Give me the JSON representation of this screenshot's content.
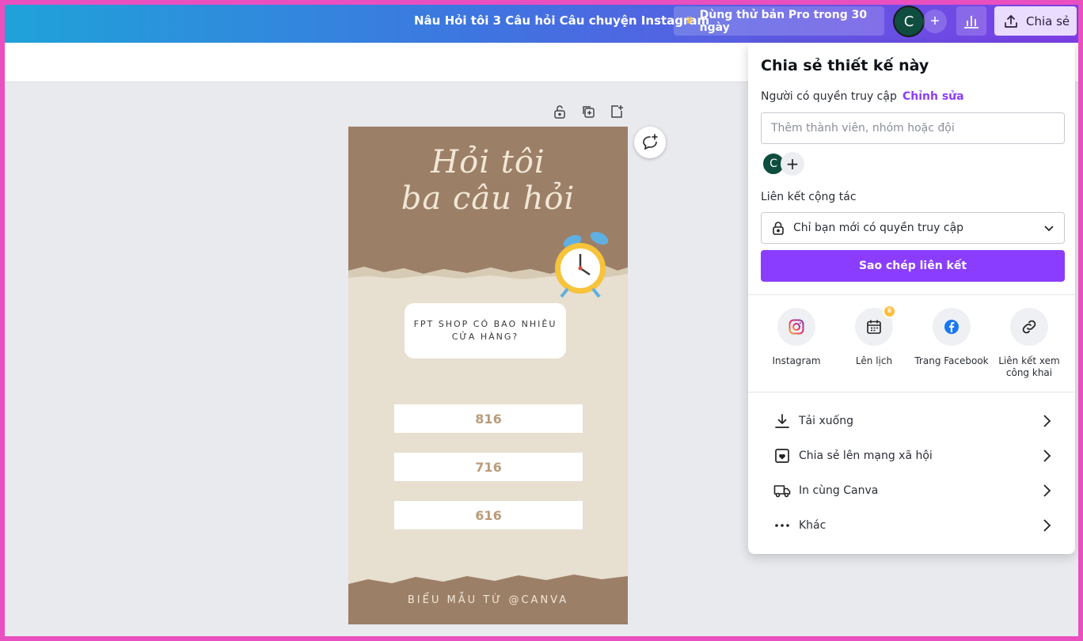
{
  "topbar": {
    "doc_title": "Nâu Hỏi tôi 3 Câu hỏi Câu chuyện Instagram",
    "pro_trial": "Dùng thử bản Pro trong 30 ngày",
    "avatar_initial": "C",
    "share_label": "Chia sẻ"
  },
  "design": {
    "title_line1": "Hỏi tôi",
    "title_line2": "ba câu hỏi",
    "question": "FPT SHOP CÓ BAO NHIÊU CỬA HÀNG?",
    "answers": [
      "816",
      "716",
      "616"
    ],
    "footer": "BIỂU MẪU TỪ @CANVA"
  },
  "share_panel": {
    "title": "Chia sẻ thiết kế này",
    "access_label": "Người có quyền truy cập",
    "edit_link": "Chỉnh sửa",
    "member_placeholder": "Thêm thành viên, nhóm hoặc đội",
    "member_initial": "C",
    "collab_label": "Liên kết cộng tác",
    "collab_value": "Chỉ bạn mới có quyền truy cập",
    "copy_link": "Sao chép liên kết",
    "options": [
      "Instagram",
      "Lên lịch",
      "Trang Facebook",
      "Liên kết xem công khai"
    ],
    "menu": [
      "Tải xuống",
      "Chia sẻ lên mạng xã hội",
      "In cùng Canva",
      "Khác"
    ]
  },
  "colors": {
    "accent": "#8b3dff",
    "kraft": "#9c7f67",
    "frame": "#ea4fbf"
  }
}
